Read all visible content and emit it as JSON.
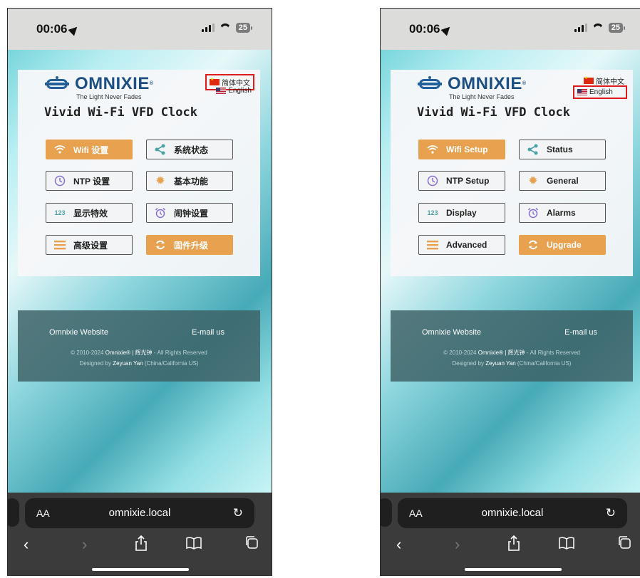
{
  "phones": {
    "left": {
      "status": {
        "time": "00:06",
        "battery": "25"
      },
      "brand": {
        "name": "OMNIXIE",
        "reg": "®",
        "tagline": "The Light Never Fades"
      },
      "page_title": "Vivid Wi-Fi VFD Clock",
      "languages": {
        "cn": "简体中文",
        "en": "English"
      },
      "highlighted_language": "cn",
      "buttons": {
        "wifi": "Wifi 设置",
        "status": "系统状态",
        "ntp": "NTP 设置",
        "general": "基本功能",
        "display": "显示特效",
        "alarms": "闹钟设置",
        "advanced": "高级设置",
        "upgrade": "固件升级"
      },
      "footer": {
        "website": "Omnixie Website",
        "email": "E-mail us",
        "copyright_pre": "© 2010-2024",
        "brand": "Omnixie® | 辉光钟",
        "rights": "- All Rights Reserved",
        "designed_by": "Designed by",
        "designer": "Zeyuan Yan",
        "location": "(China/California US)"
      },
      "browser": {
        "aa": "AA",
        "url": "omnixie.local"
      }
    },
    "right": {
      "status": {
        "time": "00:06",
        "battery": "25"
      },
      "brand": {
        "name": "OMNIXIE",
        "reg": "®",
        "tagline": "The Light Never Fades"
      },
      "page_title": "Vivid Wi-Fi VFD Clock",
      "languages": {
        "cn": "简体中文",
        "en": "English"
      },
      "highlighted_language": "en",
      "buttons": {
        "wifi": "Wifi Setup",
        "status": "Status",
        "ntp": "NTP Setup",
        "general": "General",
        "display": "Display",
        "alarms": "Alarms",
        "advanced": "Advanced",
        "upgrade": "Upgrade"
      },
      "footer": {
        "website": "Omnixie Website",
        "email": "E-mail us",
        "copyright_pre": "© 2010-2024",
        "brand": "Omnixie® | 辉光钟",
        "rights": "- All Rights Reserved",
        "designed_by": "Designed by",
        "designer": "Zeyuan Yan",
        "location": "(China/California US)"
      },
      "browser": {
        "aa": "AA",
        "url": "omnixie.local"
      }
    }
  },
  "colors": {
    "accent_orange": "#e8a14f",
    "highlight_red": "#e01b1b",
    "brand_blue": "#1d4f82",
    "icon_teal": "#4aa3a8",
    "icon_purple": "#8a6fd1"
  }
}
